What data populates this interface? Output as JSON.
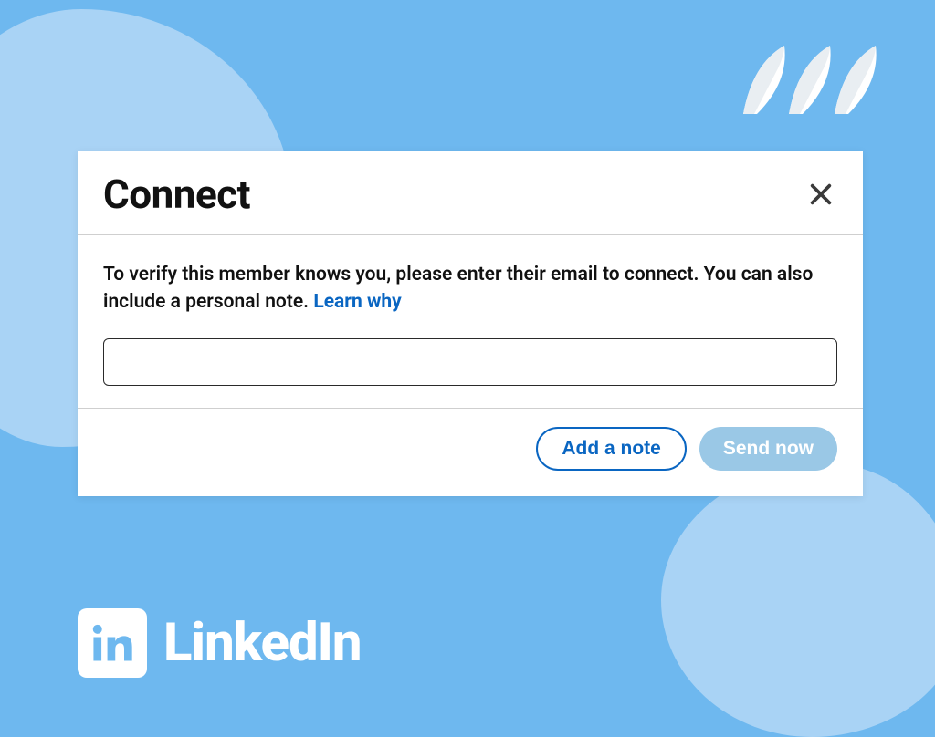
{
  "modal": {
    "title": "Connect",
    "instruction": "To verify this member knows you, please enter their email to connect. You can also include a personal note. ",
    "learn_link": "Learn why",
    "email_value": "",
    "email_placeholder": "",
    "add_note_label": "Add a note",
    "send_label": "Send now"
  },
  "brand": {
    "name": "LinkedIn"
  },
  "colors": {
    "page_bg": "#6eb8ef",
    "blob": "#a9d3f5",
    "link": "#0a66c2",
    "send_bg": "#9ac8e6"
  }
}
